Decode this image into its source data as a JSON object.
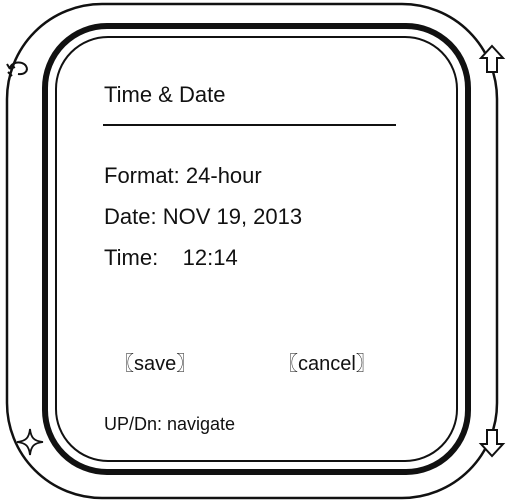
{
  "screen": {
    "title": "Time & Date",
    "fields": {
      "format": "Format: 24-hour",
      "date": "Date: NOV 19, 2013",
      "time": "Time:    12:14"
    },
    "buttons": {
      "save": "〖save〗",
      "cancel": "〖cancel〗"
    },
    "hint": "UP/Dn: navigate"
  },
  "side_icons": {
    "top_left": "rotate-icon",
    "top_right": "up-arrow-icon",
    "bottom_left": "star-sparkle-icon",
    "bottom_right": "down-arrow-icon"
  }
}
